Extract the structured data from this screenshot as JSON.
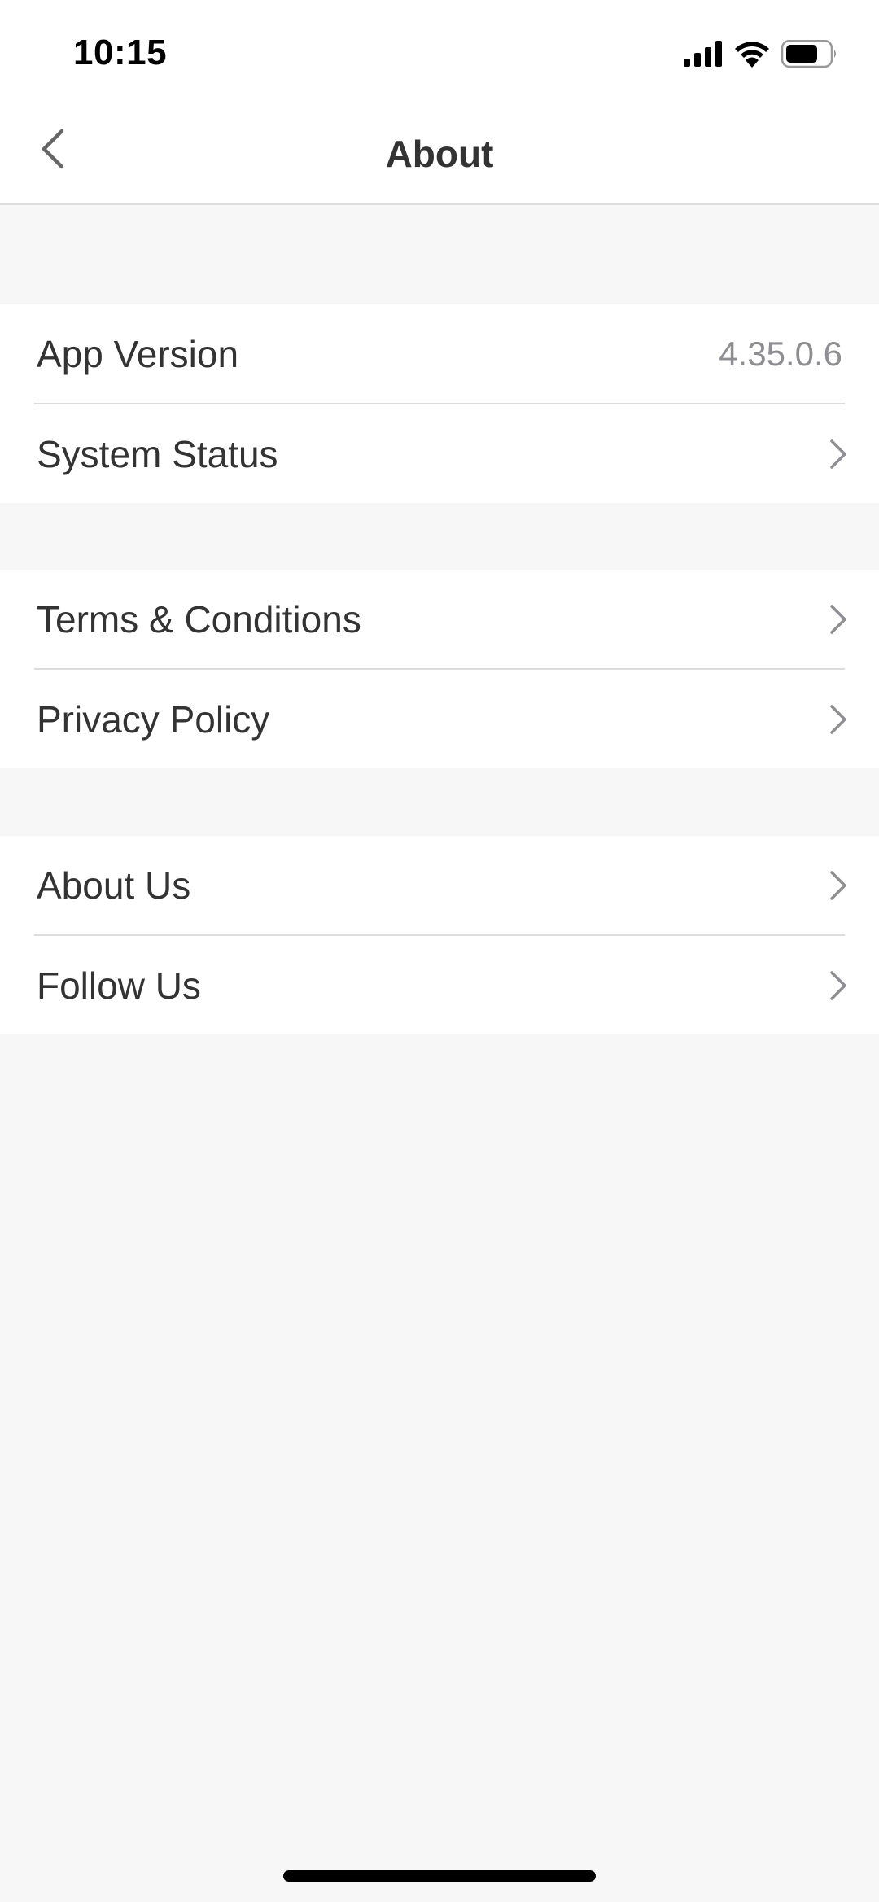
{
  "status_bar": {
    "time": "10:15",
    "icons": [
      "cellular-signal-icon",
      "wifi-icon",
      "battery-icon"
    ]
  },
  "nav": {
    "title": "About",
    "back_icon": "chevron-left-icon"
  },
  "groups": [
    {
      "items": [
        {
          "label": "App Version",
          "value": "4.35.0.6"
        },
        {
          "label": "System Status",
          "icon": "chevron-right-icon"
        }
      ]
    },
    {
      "items": [
        {
          "label": "Terms & Conditions",
          "icon": "chevron-right-icon"
        },
        {
          "label": "Privacy Policy",
          "icon": "chevron-right-icon"
        }
      ]
    },
    {
      "items": [
        {
          "label": "About Us",
          "icon": "chevron-right-icon"
        },
        {
          "label": "Follow Us",
          "icon": "chevron-right-icon"
        }
      ]
    }
  ],
  "colors": {
    "background": "#f7f7f7",
    "surface": "#ffffff",
    "text": "#333333",
    "secondary_text": "#8e8e93",
    "separator": "#dcdcdc",
    "chevron": "#8e8e93"
  }
}
